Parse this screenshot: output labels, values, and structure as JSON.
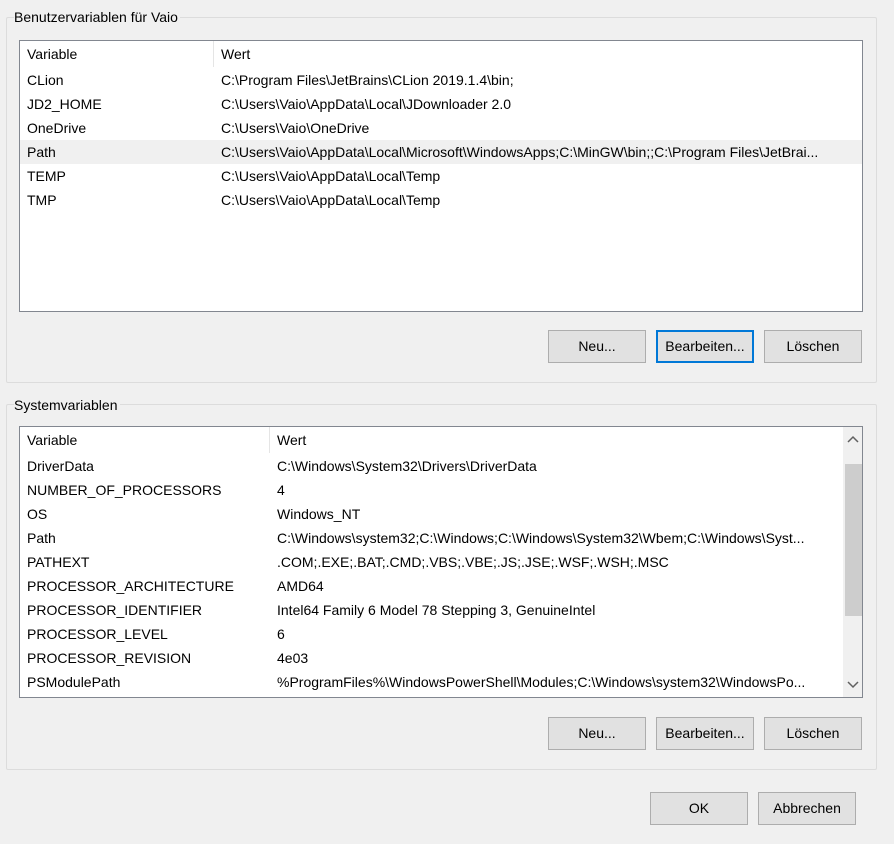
{
  "user_vars": {
    "title": "Benutzervariablen für Vaio",
    "columns": [
      "Variable",
      "Wert"
    ],
    "rows": [
      {
        "variable": "CLion",
        "value": "C:\\Program Files\\JetBrains\\CLion 2019.1.4\\bin;"
      },
      {
        "variable": "JD2_HOME",
        "value": "C:\\Users\\Vaio\\AppData\\Local\\JDownloader 2.0"
      },
      {
        "variable": "OneDrive",
        "value": "C:\\Users\\Vaio\\OneDrive"
      },
      {
        "variable": "Path",
        "value": "C:\\Users\\Vaio\\AppData\\Local\\Microsoft\\WindowsApps;C:\\MinGW\\bin;;C:\\Program Files\\JetBrai..."
      },
      {
        "variable": "TEMP",
        "value": "C:\\Users\\Vaio\\AppData\\Local\\Temp"
      },
      {
        "variable": "TMP",
        "value": "C:\\Users\\Vaio\\AppData\\Local\\Temp"
      }
    ],
    "selected_row": "Path",
    "buttons": {
      "new": "Neu...",
      "edit": "Bearbeiten...",
      "delete": "Löschen"
    }
  },
  "system_vars": {
    "title": "Systemvariablen",
    "columns": [
      "Variable",
      "Wert"
    ],
    "rows": [
      {
        "variable": "DriverData",
        "value": "C:\\Windows\\System32\\Drivers\\DriverData"
      },
      {
        "variable": "NUMBER_OF_PROCESSORS",
        "value": "4"
      },
      {
        "variable": "OS",
        "value": "Windows_NT"
      },
      {
        "variable": "Path",
        "value": "C:\\Windows\\system32;C:\\Windows;C:\\Windows\\System32\\Wbem;C:\\Windows\\Syst..."
      },
      {
        "variable": "PATHEXT",
        "value": ".COM;.EXE;.BAT;.CMD;.VBS;.VBE;.JS;.JSE;.WSF;.WSH;.MSC"
      },
      {
        "variable": "PROCESSOR_ARCHITECTURE",
        "value": "AMD64"
      },
      {
        "variable": "PROCESSOR_IDENTIFIER",
        "value": "Intel64 Family 6 Model 78 Stepping 3, GenuineIntel"
      },
      {
        "variable": "PROCESSOR_LEVEL",
        "value": "6"
      },
      {
        "variable": "PROCESSOR_REVISION",
        "value": "4e03"
      },
      {
        "variable": "PSModulePath",
        "value": "%ProgramFiles%\\WindowsPowerShell\\Modules;C:\\Windows\\system32\\WindowsPo..."
      }
    ],
    "buttons": {
      "new": "Neu...",
      "edit": "Bearbeiten...",
      "delete": "Löschen"
    },
    "scrollbar_icons": {
      "up": "chevron-up-icon",
      "down": "chevron-down-icon"
    }
  },
  "dialog": {
    "ok": "OK",
    "cancel": "Abbrechen"
  },
  "colors": {
    "focus_border": "#0078d7",
    "selected_row_bg": "#f0f0f0",
    "button_bg": "#e1e1e1"
  }
}
